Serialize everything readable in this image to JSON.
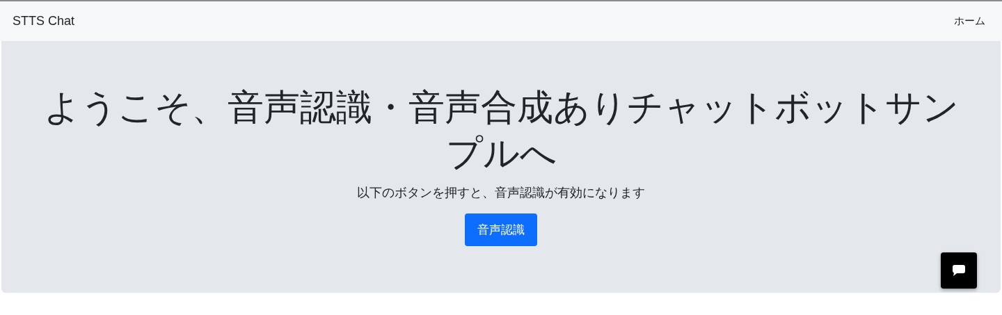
{
  "navbar": {
    "brand": "STTS Chat",
    "links": [
      {
        "label": "ホーム"
      }
    ]
  },
  "hero": {
    "title": "ようこそ、音声認識・音声合成ありチャットボットサンプルへ",
    "subtitle": "以下のボタンを押すと、音声認識が有効になります",
    "button": "音声認識"
  }
}
